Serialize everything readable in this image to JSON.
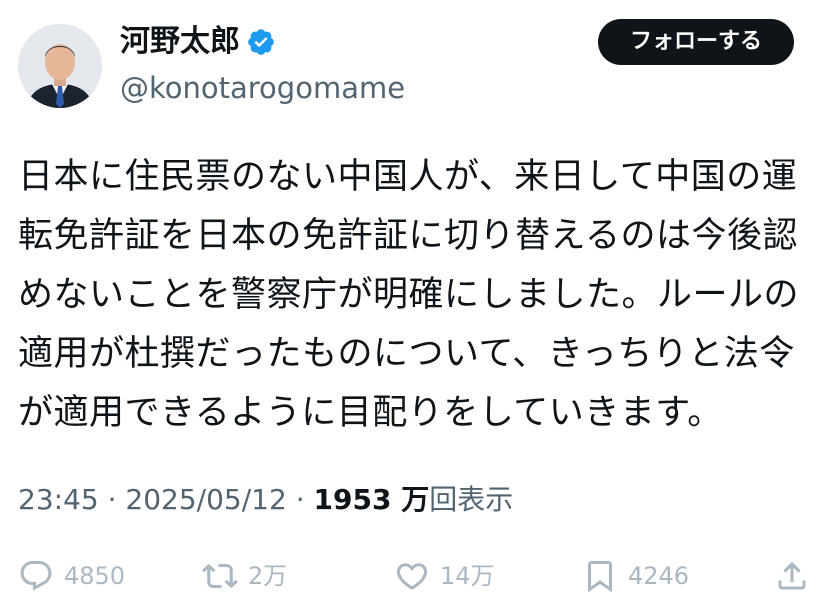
{
  "author": {
    "display_name": "河野太郎",
    "handle": "@konotarogomame",
    "verified_icon": "verified-badge-icon"
  },
  "follow_button": {
    "label": "フォローする"
  },
  "tweet": {
    "text": "日本に住民票のない中国人が、来日して中国の運\n転免許証を日本の免許証に切り替えるのは今後認\nめないことを警察庁が明確にしました。ルールの\n適用が杜撰だったものについて、きっちりと法令\nが適用できるように目配りをしていきます。",
    "time": "23:45",
    "date": "2025/05/12",
    "separator": "·",
    "views_count": "1953 万",
    "views_label": "回表示"
  },
  "actions": {
    "reply_count": "4850",
    "retweet_count": "2万",
    "like_count": "14万",
    "bookmark_count": "4246"
  },
  "colors": {
    "text_primary": "#0f1419",
    "text_secondary": "#536471",
    "action_gray": "#aab8c2",
    "verified_blue": "#1d9bf0",
    "follow_bg": "#0f1419"
  }
}
